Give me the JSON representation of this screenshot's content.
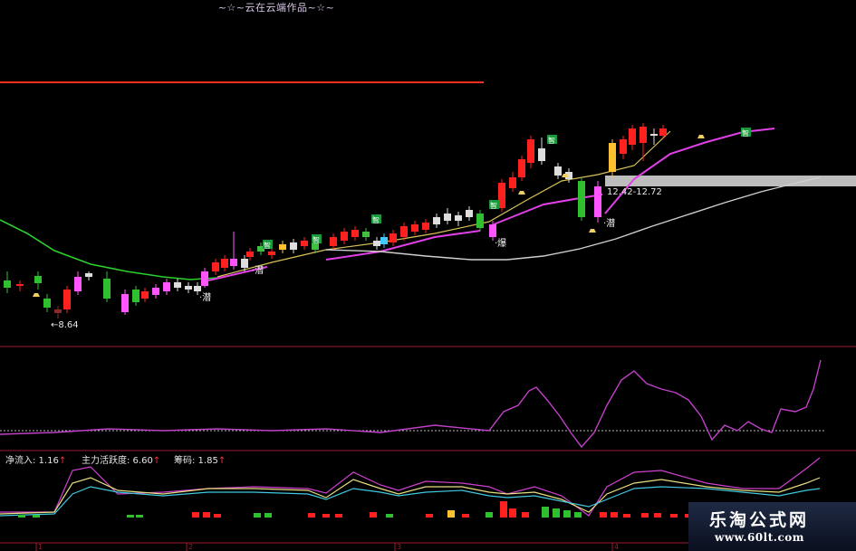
{
  "title": "~☆~云在云端作品~☆~",
  "chart_data": [
    {
      "type": "candlestick",
      "panel": "main",
      "low_label": "8.64",
      "range_label": "12.42-12.72",
      "annotations": [
        "潜",
        "潜",
        "爆",
        "潜"
      ],
      "signal_tags": [
        "智",
        "智",
        "智",
        "智",
        "智",
        "智"
      ],
      "series": [
        {
          "name": "green_ma",
          "color": "#2bd12b"
        },
        {
          "name": "yellow_ma",
          "color": "#d8c25a"
        },
        {
          "name": "magenta_ma",
          "color": "#e040e8"
        },
        {
          "name": "gray_ma",
          "color": "#cfcfcf"
        }
      ]
    },
    {
      "type": "line",
      "panel": "oscillator",
      "series": [
        {
          "name": "oscillator",
          "color": "#c040c8"
        }
      ],
      "baseline": "dashed"
    },
    {
      "type": "line+bar",
      "panel": "indicators",
      "legend": [
        {
          "label": "净流入: 1.16",
          "arrow": "↑"
        },
        {
          "label": "主力活跃度: 6.60",
          "arrow": "↑"
        },
        {
          "label": "筹码: 1.85",
          "arrow": "↑"
        }
      ],
      "series": [
        {
          "name": "line1",
          "color": "#d040d0"
        },
        {
          "name": "line2",
          "color": "#e8e080"
        },
        {
          "name": "line3",
          "color": "#40c8e0"
        }
      ]
    }
  ],
  "axis_ticks": [
    "1",
    "2",
    "3",
    "4"
  ],
  "watermark": {
    "line1": "乐淘公式网",
    "line2": "www.60lt.com"
  }
}
